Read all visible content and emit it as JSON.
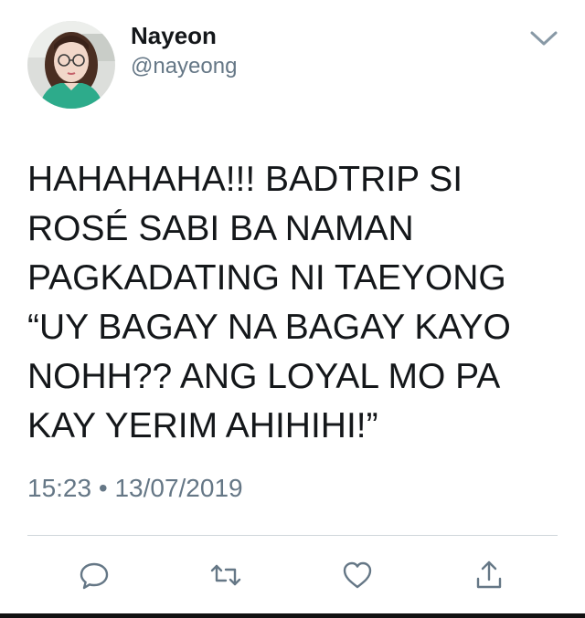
{
  "user": {
    "display_name": "Nayeon",
    "handle": "@nayeong"
  },
  "tweet": {
    "text": "HAHAHAHA!!! BADTRIP SI\nROSÉ SABI BA NAMAN\nPAGKADATING NI TAEYONG\n“UY BAGAY NA BAGAY KAYO\nNOHH?? ANG LOYAL MO PA\nKAY YERIM AHIHIHI!”",
    "time": "15:23",
    "separator": "•",
    "date": "13/07/2019"
  },
  "icons": {
    "menu": "chevron-down-icon",
    "reply": "reply-icon",
    "retweet": "retweet-icon",
    "like": "heart-icon",
    "share": "share-icon"
  },
  "colors": {
    "text": "#14171a",
    "secondary_text": "#657786",
    "icon": "#657786",
    "divider": "#cfd6db"
  }
}
